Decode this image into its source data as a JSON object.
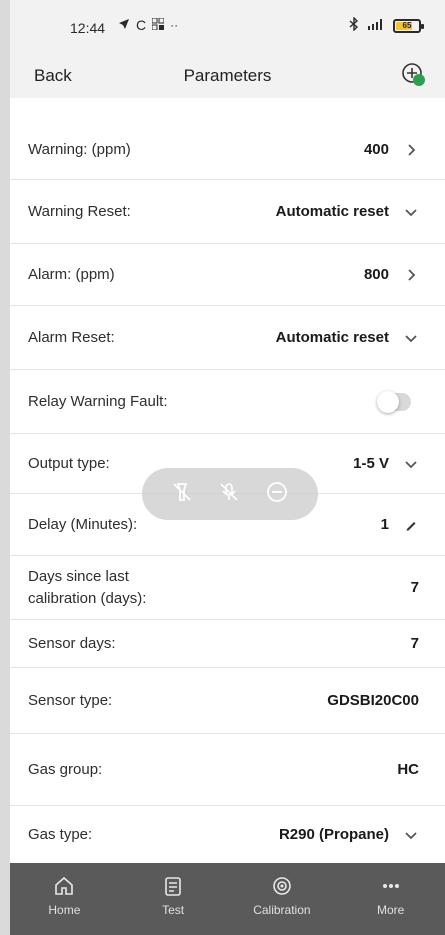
{
  "status_bar": {
    "time": "12:44",
    "left_icons": [
      "navigation-icon",
      "c-icon",
      "grid-icon",
      "more-dots-icon"
    ],
    "right_icons": [
      "bluetooth-icon",
      "signal-icon",
      "battery-icon"
    ],
    "battery_level": "65"
  },
  "header": {
    "back_label": "Back",
    "title": "Parameters",
    "action_icon": "add-device-icon"
  },
  "rows": [
    {
      "label": "Warning: (ppm)",
      "value": "400",
      "control": "chevron-right-icon"
    },
    {
      "label": "Warning Reset:",
      "value": "Automatic reset",
      "control": "chevron-down-icon"
    },
    {
      "label": "Alarm: (ppm)",
      "value": "800",
      "control": "chevron-right-icon"
    },
    {
      "label": "Alarm Reset:",
      "value": "Automatic reset",
      "control": "chevron-down-icon"
    },
    {
      "label": "Relay Warning Fault:",
      "value": "",
      "control": "toggle",
      "toggle_on": false
    },
    {
      "label": "Output type:",
      "value": "1-5 V",
      "control": "chevron-down-icon"
    },
    {
      "label": "Delay (Minutes):",
      "value": "1",
      "control": "pencil-icon"
    },
    {
      "label_line1": "Days since last",
      "label_line2": "calibration (days):",
      "value": "7"
    },
    {
      "label": "Sensor days:",
      "value": "7"
    },
    {
      "label": "Sensor type:",
      "value": "GDSBI20C00"
    },
    {
      "label": "Gas group:",
      "value": "HC"
    },
    {
      "label": "Gas type:",
      "value": "R290 (Propane)",
      "control": "chevron-down-icon"
    }
  ],
  "floating_toolbar": {
    "icons": [
      "flashlight-off-icon",
      "mic-off-icon",
      "minus-circle-icon"
    ]
  },
  "bottom_nav": [
    {
      "label": "Home",
      "icon": "home-icon"
    },
    {
      "label": "Test",
      "icon": "test-icon"
    },
    {
      "label": "Calibration",
      "icon": "calibration-icon"
    },
    {
      "label": "More",
      "icon": "more-icon"
    }
  ],
  "colors": {
    "header_bg": "#f2f2f2",
    "nav_bg": "#5a5a5a",
    "add_badge": "#2e9e4f"
  }
}
